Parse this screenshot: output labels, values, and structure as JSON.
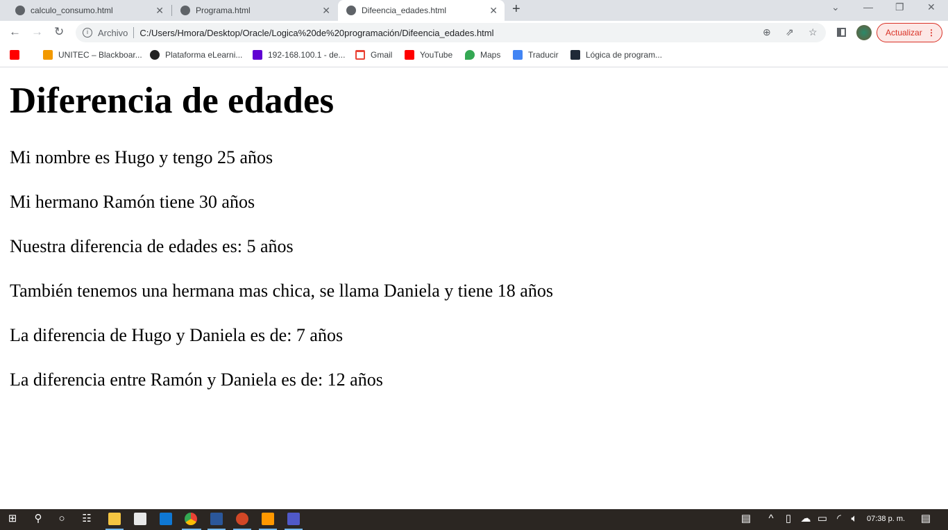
{
  "browser": {
    "tabs": [
      {
        "title": "calculo_consumo.html",
        "active": false
      },
      {
        "title": "Programa.html",
        "active": false
      },
      {
        "title": "Difeencia_edades.html",
        "active": true
      }
    ],
    "address": {
      "scheme_label": "Archivo",
      "url": "C:/Users/Hmora/Desktop/Oracle/Logica%20de%20programación/Difeencia_edades.html"
    },
    "update_button": "Actualizar",
    "bookmarks": [
      {
        "label": "",
        "icon": "youtube-icon",
        "color": "#ff0000"
      },
      {
        "label": "UNITEC – Blackboar...",
        "icon": "pencil-icon",
        "color": "#f29900"
      },
      {
        "label": "Plataforma eLearni...",
        "icon": "globe-icon",
        "color": "#222222"
      },
      {
        "label": "192-168.100.1 - de...",
        "icon": "yahoo-icon",
        "color": "#6001d2"
      },
      {
        "label": "Gmail",
        "icon": "gmail-icon",
        "color": "#ea4335"
      },
      {
        "label": "YouTube",
        "icon": "youtube-icon",
        "color": "#ff0000"
      },
      {
        "label": "Maps",
        "icon": "maps-icon",
        "color": "#34a853"
      },
      {
        "label": "Traducir",
        "icon": "translate-icon",
        "color": "#4285f4"
      },
      {
        "label": "Lógica de program...",
        "icon": "bookmark-icon",
        "color": "#1f2937"
      }
    ]
  },
  "page": {
    "heading": "Diferencia de edades",
    "paragraphs": [
      "Mi nombre es Hugo y tengo 25 años",
      "Mi hermano Ramón tiene 30 años",
      "Nuestra diferencia de edades es: 5 años",
      "También tenemos una hermana mas chica, se llama Daniela y tiene 18 años",
      "La diferencia de Hugo y Daniela es de: 7 años",
      "La diferencia entre Ramón y Daniela es de: 12 años"
    ]
  },
  "taskbar": {
    "clock": "07:38 p. m.",
    "apps": [
      {
        "name": "file-explorer",
        "color": "#f4c542"
      },
      {
        "name": "store",
        "color": "#e8e8e8"
      },
      {
        "name": "mail",
        "color": "#0f78d4"
      },
      {
        "name": "chrome",
        "color": "#4caf50"
      },
      {
        "name": "word",
        "color": "#2b579a"
      },
      {
        "name": "powerpoint",
        "color": "#d24726"
      },
      {
        "name": "sublime-text",
        "color": "#ff9800"
      },
      {
        "name": "teams",
        "color": "#5059c9"
      }
    ]
  }
}
